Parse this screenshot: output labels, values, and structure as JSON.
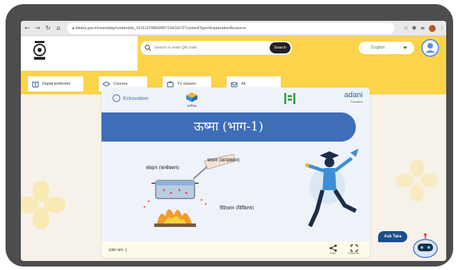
{
  "browser": {
    "url": "diksha.gov.in/ncert/play/content/do_31311379984280710411672?contentType=ExplanationResource",
    "icons": [
      "back-arrow-icon",
      "forward-arrow-icon",
      "reload-icon",
      "home-icon",
      "lock-icon"
    ]
  },
  "header": {
    "search": {
      "placeholder": "Search or enter QR code",
      "button": "Search"
    },
    "language": "English",
    "categories": [
      {
        "label": "Digital textbooks",
        "icon": "book-icon"
      },
      {
        "label": "Courses",
        "icon": "courses-icon"
      },
      {
        "label": "TV classes",
        "icon": "tv-icon"
      },
      {
        "label": "All",
        "icon": "all-icon"
      }
    ]
  },
  "content": {
    "partners": {
      "left": "Eckovation",
      "center": "सर्वाशिक्षा",
      "right": "adani",
      "right_sub": "Foundation"
    },
    "title": "ऊष्मा (भाग-1)",
    "labels": {
      "conduction": "चालन (कन्डक्शन)",
      "convection": "संवहन (कन्वेक्शन)",
      "radiation": "रेडिएशन (विकिरण)"
    },
    "footer_title": "ऊष्मा भाग- 1",
    "share": "Share",
    "fullscreen": "Fullscreen"
  },
  "assistant": {
    "label": "Ask Tara"
  },
  "colors": {
    "header": "#fbd44a",
    "banner": "#3e6eb8",
    "accent": "#1a4f8e"
  }
}
